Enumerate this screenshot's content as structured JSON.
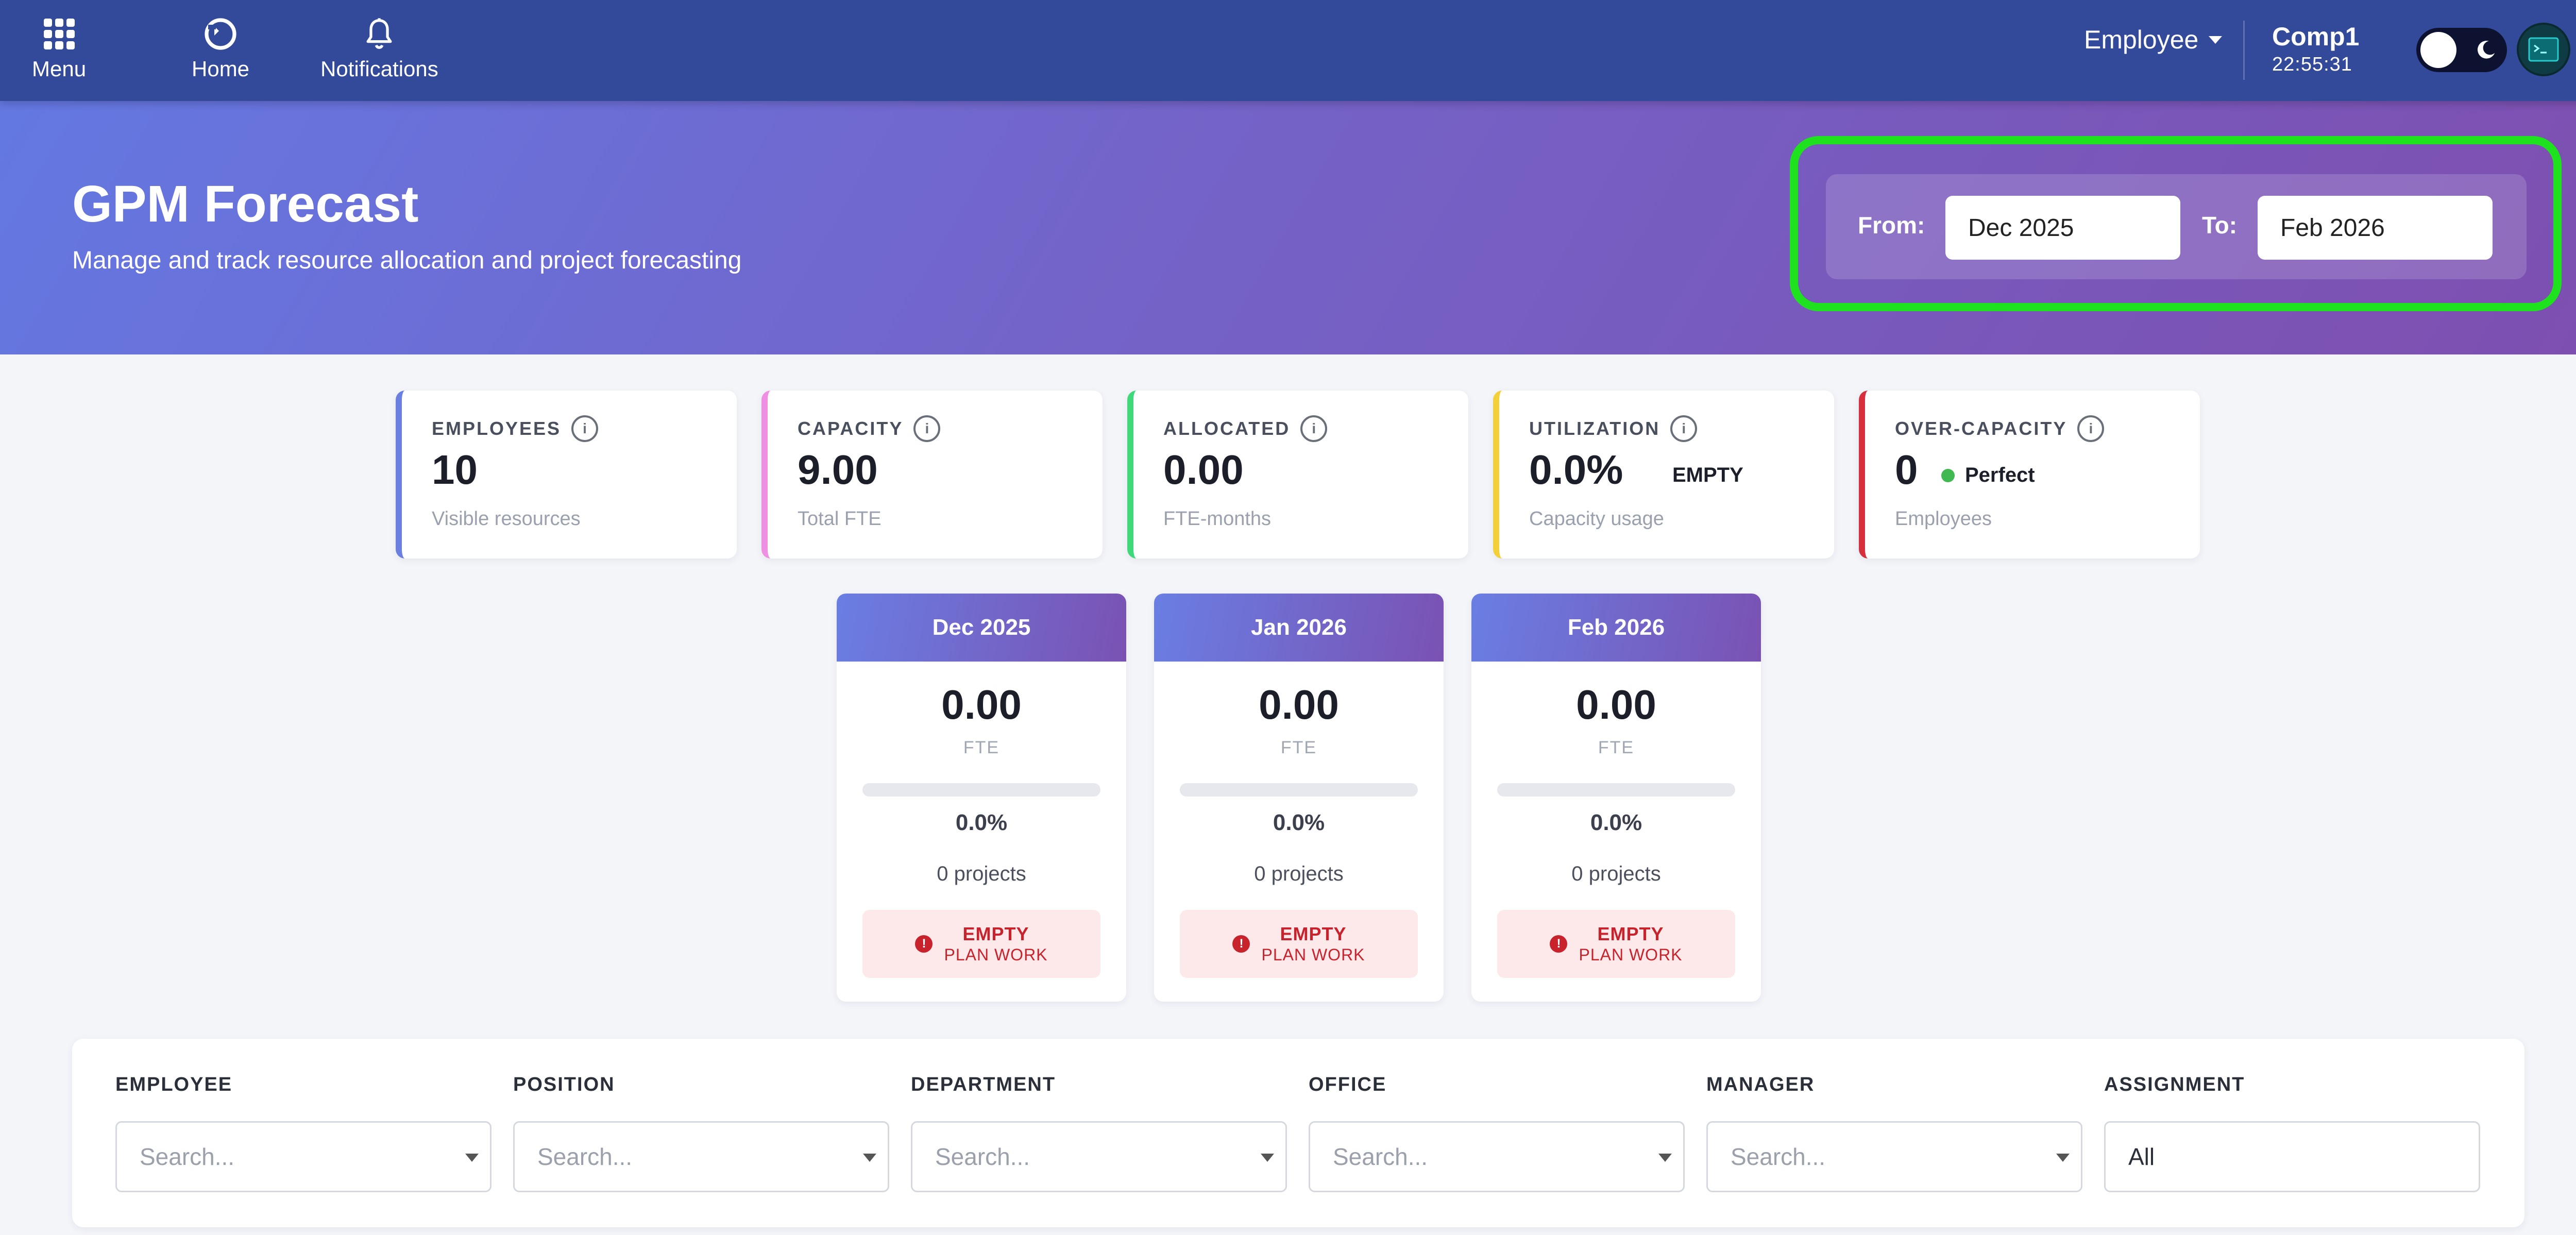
{
  "nav": {
    "menu_label": "Menu",
    "home_label": "Home",
    "notifications_label": "Notifications",
    "role": "Employee",
    "company": "Comp1",
    "clock": "22:55:31"
  },
  "hero": {
    "title": "GPM Forecast",
    "subtitle": "Manage and track resource allocation and project forecasting",
    "from_label": "From:",
    "from_value": "Dec 2025",
    "to_label": "To:",
    "to_value": "Feb 2026",
    "highlight_color": "#1ee21e"
  },
  "stats": [
    {
      "label": "EMPLOYEES",
      "value": "10",
      "badge": "",
      "sub": "Visible resources",
      "accent": "#6a7fe0"
    },
    {
      "label": "CAPACITY",
      "value": "9.00",
      "badge": "",
      "sub": "Total FTE",
      "accent": "#ef8fe4"
    },
    {
      "label": "ALLOCATED",
      "value": "0.00",
      "badge": "",
      "sub": "FTE-months",
      "accent": "#3fd97a"
    },
    {
      "label": "UTILIZATION",
      "value": "0.0%",
      "badge": "EMPTY",
      "sub": "Capacity usage",
      "accent": "#f3d03a"
    },
    {
      "label": "OVER-CAPACITY",
      "value": "0",
      "badge": "Perfect",
      "sub": "Employees",
      "accent": "#d7303c"
    }
  ],
  "months": [
    {
      "month": "Dec 2025",
      "value": "0.00",
      "unit": "FTE",
      "utilization": "0.0%",
      "utilization_fraction": 0,
      "projects": "0 projects",
      "status": "EMPTY",
      "status_sub": "PLAN WORK"
    },
    {
      "month": "Jan 2026",
      "value": "0.00",
      "unit": "FTE",
      "utilization": "0.0%",
      "utilization_fraction": 0,
      "projects": "0 projects",
      "status": "EMPTY",
      "status_sub": "PLAN WORK"
    },
    {
      "month": "Feb 2026",
      "value": "0.00",
      "unit": "FTE",
      "utilization": "0.0%",
      "utilization_fraction": 0,
      "projects": "0 projects",
      "status": "EMPTY",
      "status_sub": "PLAN WORK"
    }
  ],
  "filters": [
    {
      "label": "EMPLOYEE",
      "placeholder": "Search...",
      "value": ""
    },
    {
      "label": "POSITION",
      "placeholder": "Search...",
      "value": ""
    },
    {
      "label": "DEPARTMENT",
      "placeholder": "Search...",
      "value": ""
    },
    {
      "label": "OFFICE",
      "placeholder": "Search...",
      "value": ""
    },
    {
      "label": "MANAGER",
      "placeholder": "Search...",
      "value": ""
    },
    {
      "label": "ASSIGNMENT",
      "placeholder": "",
      "value": "All"
    }
  ],
  "icons": {
    "info": "i",
    "alert": "!"
  }
}
